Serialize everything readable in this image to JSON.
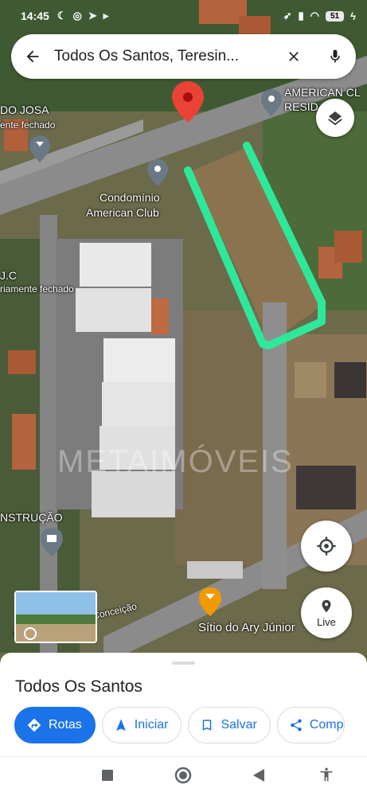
{
  "status_bar": {
    "time": "14:45",
    "battery": "51",
    "left_icons": [
      "moon-icon",
      "instagram-icon",
      "telegram-icon",
      "play-icon"
    ],
    "right_icons": [
      "location-icon",
      "signal-icon",
      "wifi-icon",
      "battery-icon",
      "charging-icon"
    ]
  },
  "search": {
    "query": "Todos Os Santos, Teresin...",
    "back_icon": "arrow-left-icon",
    "clear_icon": "close-icon",
    "mic_icon": "mic-icon"
  },
  "map": {
    "labels": {
      "american_club_res_1": "AMERICAN CL",
      "american_club_res_2": "RESID",
      "do_josa": "DO JOSA",
      "fechado_1": "ente fechado",
      "condominio_1": "Condomínio",
      "condominio_2": "American Club",
      "jc": "J.C",
      "fechado_2": "riamente fechado",
      "construcao": "NSTRUÇÃO",
      "sitio": "Sítio do Ary Júnior",
      "street": "R. Nossa Senhora Conceição",
      "watermark": "METAIMÓVEIS"
    },
    "highlight_color": "#2ee89a",
    "pin_color": "#ea4335"
  },
  "controls": {
    "layers_icon": "layers-icon",
    "location_icon": "my-location-icon",
    "live_label": "Live"
  },
  "sheet": {
    "title": "Todos Os Santos",
    "chips": [
      {
        "label": "Rotas",
        "icon": "directions-icon"
      },
      {
        "label": "Iniciar",
        "icon": "navigation-icon"
      },
      {
        "label": "Salvar",
        "icon": "bookmark-icon"
      },
      {
        "label": "Comp",
        "icon": "share-icon"
      }
    ]
  },
  "navbar": {
    "icons": [
      "recents-icon",
      "home-icon",
      "back-icon",
      "accessibility-icon"
    ]
  }
}
